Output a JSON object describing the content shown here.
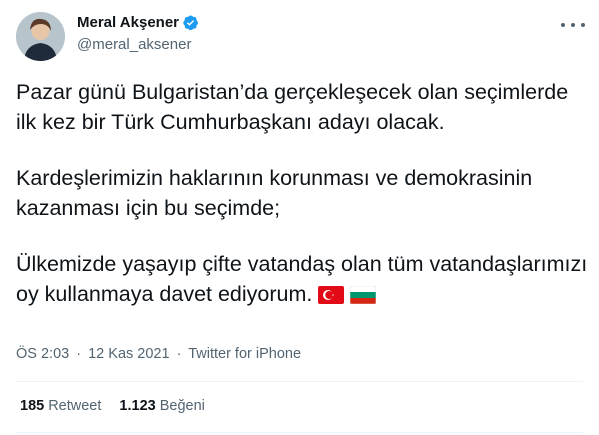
{
  "author": {
    "display_name": "Meral Akşener",
    "handle": "@meral_aksener",
    "verified_icon": "verified-badge-icon"
  },
  "tweet": {
    "paragraphs": [
      "Pazar günü Bulgaristan’da gerçekleşecek olan seçimlerde ilk kez bir Türk Cumhurbaşkanı adayı olacak.",
      "Kardeşlerimizin haklarının korunması ve demokrasinin kazanması için bu seçimde;",
      "Ülkemizde yaşayıp çifte vatandaş olan tüm vatandaşlarımızı oy kullanmaya davet ediyorum."
    ],
    "emoji": [
      "turkey-flag-icon",
      "bulgaria-flag-icon"
    ]
  },
  "meta": {
    "time": "ÖS 2:03",
    "date": "12 Kas 2021",
    "separator": "·",
    "source": "Twitter for iPhone"
  },
  "stats": {
    "retweets_count": "185",
    "retweets_label": "Retweet",
    "likes_count": "1.123",
    "likes_label": "Beğeni"
  },
  "colors": {
    "text": "#0f1419",
    "secondary": "#536471",
    "verified": "#1d9bf0",
    "divider": "#eff3f4"
  }
}
